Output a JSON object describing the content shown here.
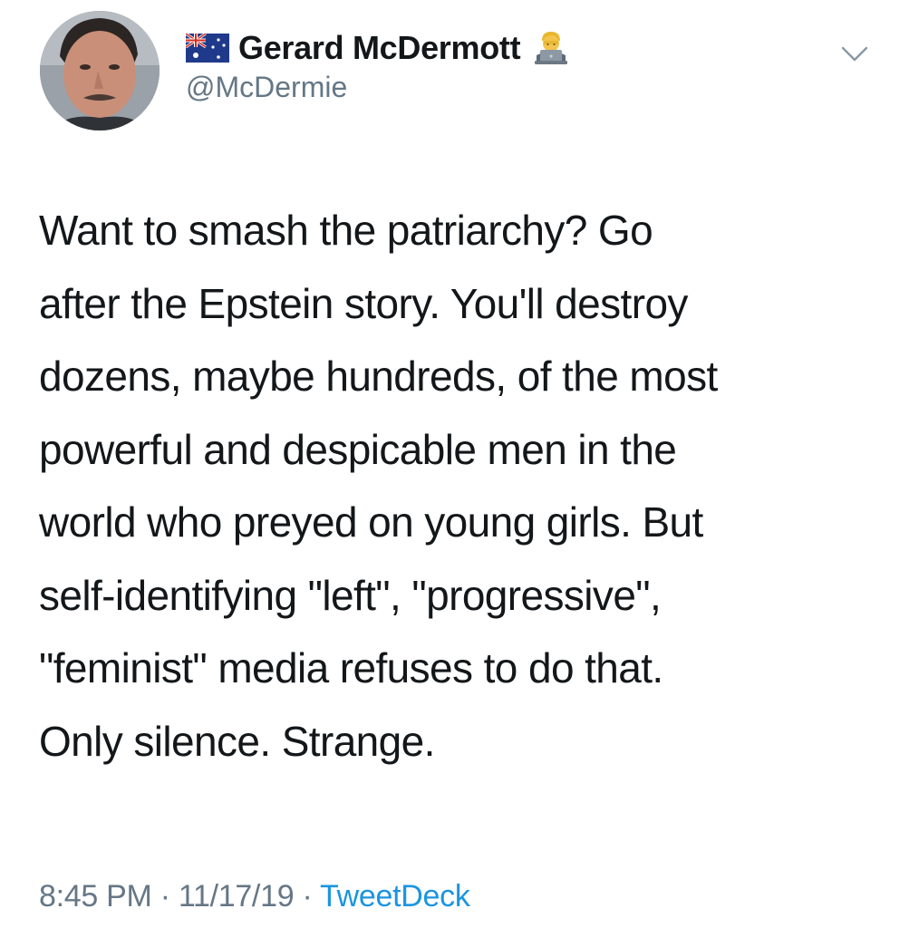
{
  "user": {
    "display_name": "Gerard McDermott",
    "handle": "@McDermie",
    "flag_icon": "australia-flag-icon",
    "badge_icon": "technologist-emoji-icon"
  },
  "menu": {
    "icon": "chevron-down-icon"
  },
  "tweet": {
    "lines": [
      "Want to smash the patriarchy? Go",
      "after the Epstein story. You'll destroy",
      "dozens, maybe hundreds, of the most",
      "powerful and despicable men in the",
      "world who preyed on young girls. But",
      "self-identifying \"left\", \"progressive\",",
      "\"feminist\" media refuses to do that.",
      "Only silence. Strange."
    ]
  },
  "meta": {
    "time": "8:45 PM",
    "separator": "·",
    "date": "11/17/19",
    "source": "TweetDeck"
  },
  "colors": {
    "text": "#14171a",
    "secondary": "#657786",
    "link": "#1b95e0"
  }
}
